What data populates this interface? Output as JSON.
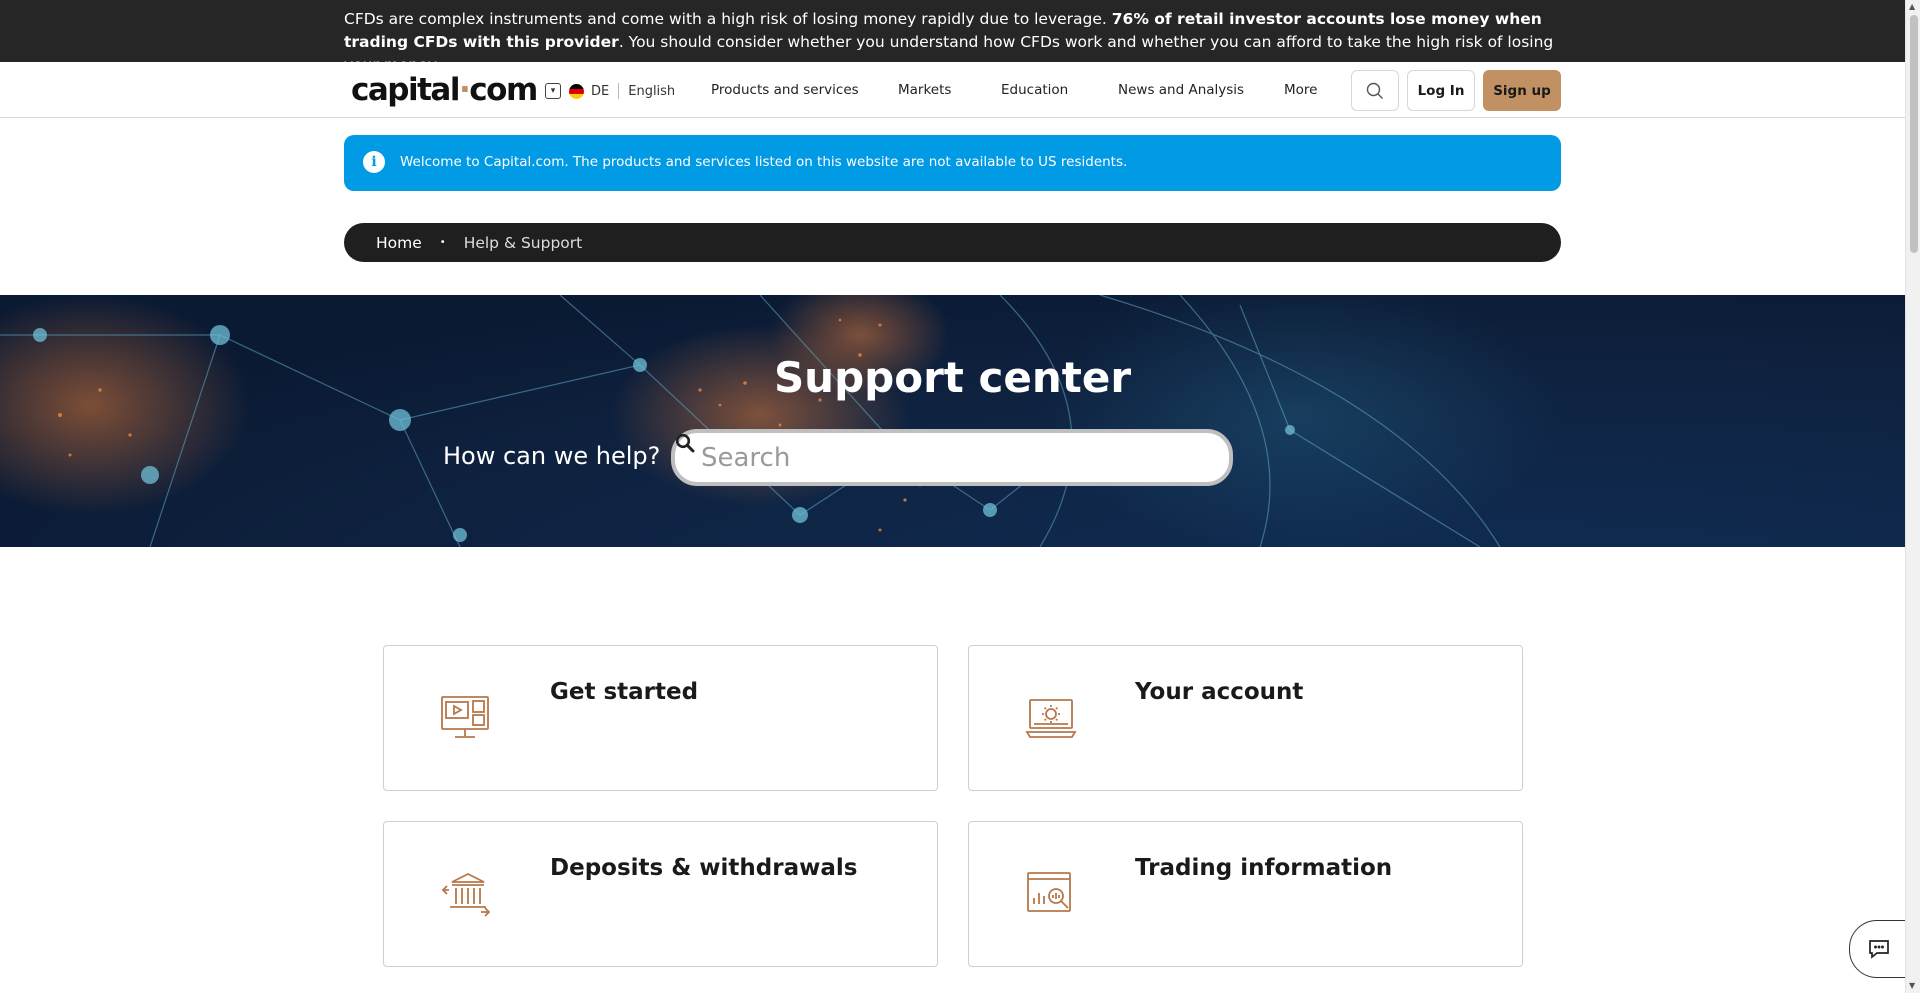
{
  "risk_warning": {
    "part1": "CFDs are complex instruments and come with a high risk of losing money rapidly due to leverage. ",
    "bold": "76% of retail investor accounts lose money when trading CFDs with this provider",
    "part2": ". You should consider whether you understand how CFDs work and whether you can afford to take the high risk of losing your money."
  },
  "header": {
    "logo_left": "capital",
    "logo_dot": "·",
    "logo_right": "com",
    "country": "DE",
    "language": "English",
    "nav": [
      "Products and services",
      "Markets",
      "Education",
      "News and Analysis",
      "More"
    ],
    "login_label": "Log In",
    "signup_label": "Sign up"
  },
  "notice": {
    "text": "Welcome to Capital.com. The products and services listed on this website are not available to US residents.",
    "close": "✕"
  },
  "breadcrumb": {
    "home": "Home",
    "separator": "•",
    "current": "Help & Support"
  },
  "hero": {
    "title": "Support center",
    "help_text": "How can we help?",
    "search_placeholder": "Search"
  },
  "cards": [
    {
      "title": "Get started",
      "icon": "video-monitor-icon"
    },
    {
      "title": "Your account",
      "icon": "laptop-gear-icon"
    },
    {
      "title": "Deposits & withdrawals",
      "icon": "bank-transfer-icon"
    },
    {
      "title": "Trading information",
      "icon": "chart-magnifier-icon"
    }
  ],
  "colors": {
    "brand_accent": "#c19163",
    "icon_color": "#b7774a",
    "notice_blue": "#009ae5",
    "dark": "#262626"
  }
}
